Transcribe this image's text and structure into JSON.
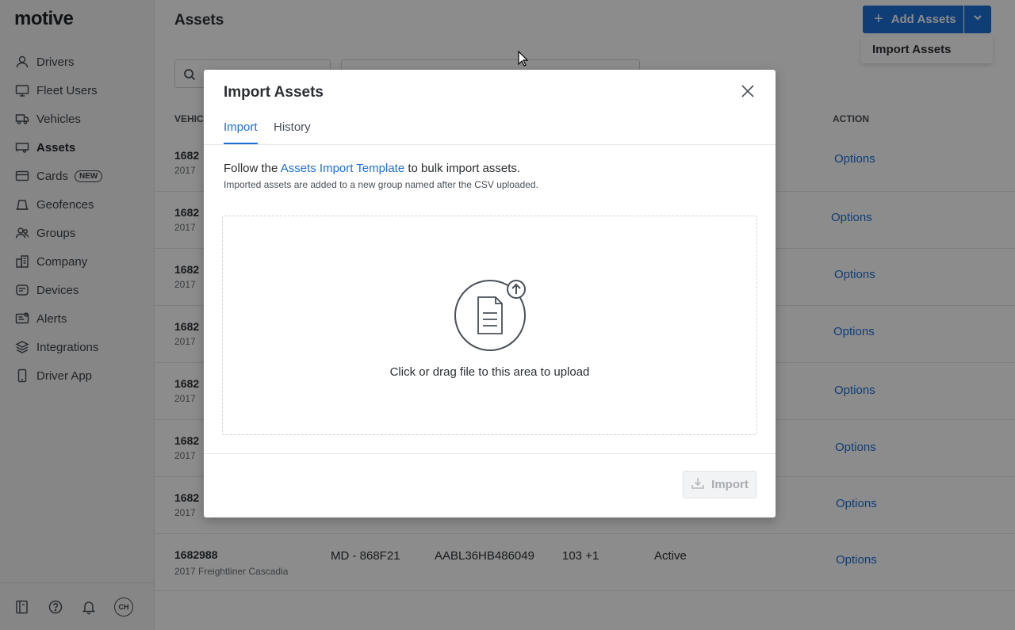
{
  "sidebar": {
    "logo": "motive",
    "items": [
      {
        "label": "Drivers",
        "icon": "person-icon"
      },
      {
        "label": "Fleet Users",
        "icon": "monitor-icon"
      },
      {
        "label": "Vehicles",
        "icon": "truck-icon"
      },
      {
        "label": "Assets",
        "icon": "trailer-icon"
      },
      {
        "label": "Cards",
        "icon": "card-icon",
        "badge": "NEW"
      },
      {
        "label": "Geofences",
        "icon": "geofence-icon"
      },
      {
        "label": "Groups",
        "icon": "group-icon"
      },
      {
        "label": "Company",
        "icon": "building-icon"
      },
      {
        "label": "Devices",
        "icon": "device-icon"
      },
      {
        "label": "Alerts",
        "icon": "alert-icon"
      },
      {
        "label": "Integrations",
        "icon": "layers-icon"
      },
      {
        "label": "Driver App",
        "icon": "phone-icon"
      }
    ],
    "avatar": "CH"
  },
  "header": {
    "title": "Assets",
    "add_button": "Add Assets",
    "dropdown_item": "Import Assets"
  },
  "table": {
    "headers": {
      "vehicle": "VEHIC",
      "action": "ACTION"
    },
    "rows": [
      {
        "id": "1682",
        "sub": "2017",
        "options": "Options"
      },
      {
        "id": "1682",
        "sub": "2017",
        "options": "Options"
      },
      {
        "id": "1682",
        "sub": "2017",
        "options": "Options"
      },
      {
        "id": "1682",
        "sub": "2017",
        "options": "Options"
      },
      {
        "id": "1682",
        "sub": "2017",
        "options": "Options"
      },
      {
        "id": "1682",
        "sub": "2017",
        "options": "Options"
      },
      {
        "id": "1682",
        "sub": "2017",
        "options": "Options"
      },
      {
        "id": "1682988",
        "sub": "2017 Freightliner Cascadia",
        "plate": "MD - 868F21",
        "vin": "AABL36HB486049",
        "groups": "103 +1",
        "status": "Active",
        "options": "Options"
      }
    ]
  },
  "modal": {
    "title": "Import Assets",
    "tabs": [
      "Import",
      "History"
    ],
    "intro_before": "Follow the ",
    "intro_link": "Assets Import Template",
    "intro_after": " to bulk import assets.",
    "note": "Imported assets are added to a new group named after the CSV uploaded.",
    "dropzone_text": "Click or drag file to this area to upload",
    "import_button": "Import"
  },
  "colors": {
    "accent": "#1d6fd6"
  }
}
